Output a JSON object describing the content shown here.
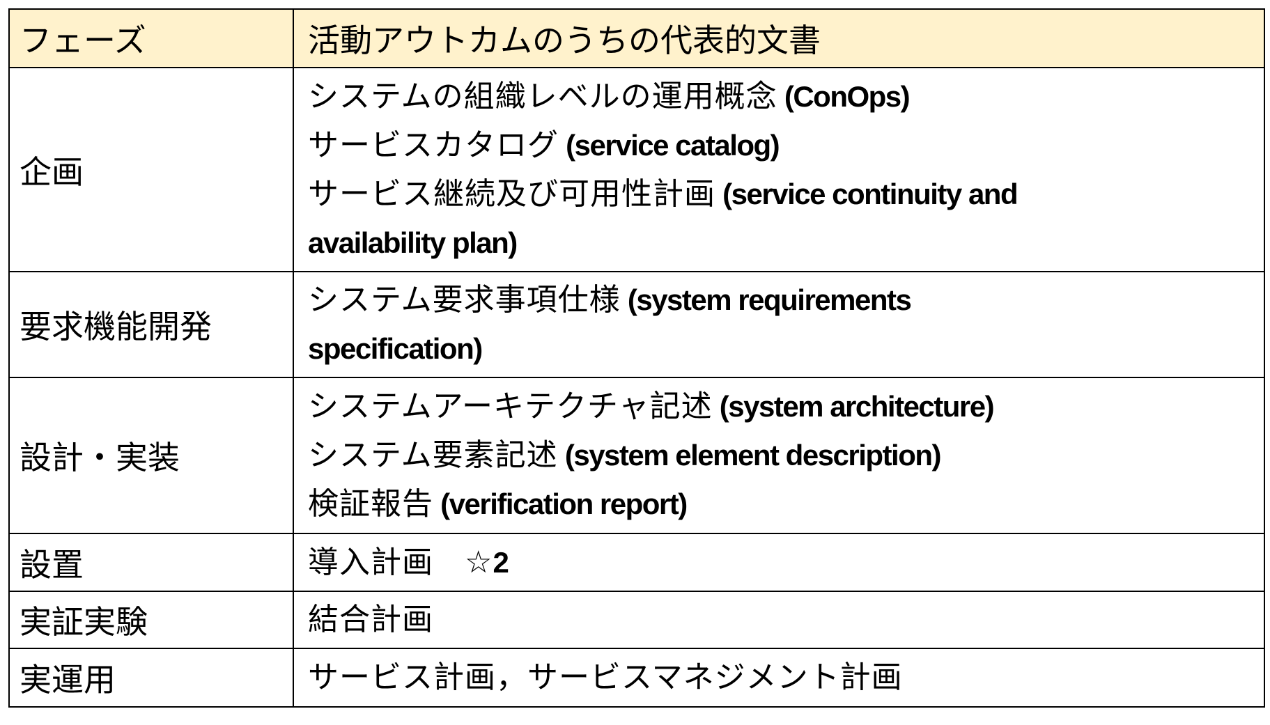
{
  "table": {
    "header": {
      "phase": "フェーズ",
      "documents": "活動アウトカムのうちの代表的文書"
    },
    "header_bg_color": "#FFF2CC",
    "rows": [
      {
        "phase": "企画",
        "documents": [
          {
            "jp": "システムの組織レベルの運用概念",
            "en": " (ConOps)"
          },
          {
            "jp": "サービスカタログ",
            "en": " (service catalog)"
          },
          {
            "jp": "サービス継続及び可用性計画",
            "en": " (service continuity and"
          },
          {
            "jp": "",
            "en": "availability plan)"
          }
        ]
      },
      {
        "phase": "要求機能開発",
        "documents": [
          {
            "jp": "システム要求事項仕様",
            "en": " (system requirements"
          },
          {
            "jp": "",
            "en": "specification)"
          }
        ]
      },
      {
        "phase": "設計・実装",
        "documents": [
          {
            "jp": "システムアーキテクチャ記述",
            "en": " (system architecture)"
          },
          {
            "jp": "システム要素記述",
            "en": " (system element description)"
          },
          {
            "jp": "検証報告",
            "en": " (verification report)"
          }
        ]
      },
      {
        "phase": "設置",
        "documents": [
          {
            "jp": "導入計画　☆",
            "en": "2"
          }
        ]
      },
      {
        "phase": "実証実験",
        "documents": [
          {
            "jp": "結合計画",
            "en": ""
          }
        ]
      },
      {
        "phase": "実運用",
        "documents": [
          {
            "jp": "サービス計画，サービスマネジメント計画",
            "en": ""
          }
        ]
      }
    ]
  }
}
